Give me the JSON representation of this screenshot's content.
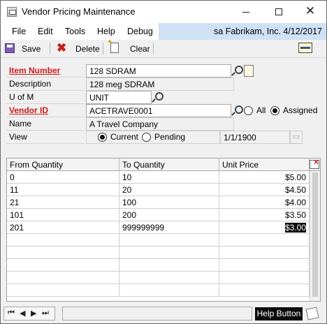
{
  "window": {
    "title": "Vendor Pricing Maintenance",
    "minimize": "–",
    "maximize": "☐",
    "close": "✕"
  },
  "menu": {
    "items": [
      "File",
      "Edit",
      "Tools",
      "Help",
      "Debug"
    ],
    "context": "sa  Fabrikam, Inc.  4/12/2017"
  },
  "toolbar": {
    "save_label": "Save",
    "delete_label": "Delete",
    "clear_label": "Clear"
  },
  "form": {
    "item_number_label": "Item Number",
    "item_number_value": "128 SDRAM",
    "description_label": "Description",
    "description_value": "128 meg SDRAM",
    "uofm_label": "U of M",
    "uofm_value": "UNIT",
    "vendor_id_label": "Vendor ID",
    "vendor_id_value": "ACETRAVE0001",
    "vendor_scope": {
      "options": [
        "All",
        "Assigned"
      ],
      "selected": "Assigned"
    },
    "name_label": "Name",
    "name_value": "A Travel Company",
    "view_label": "View",
    "view_options": {
      "options": [
        "Current",
        "Pending"
      ],
      "selected": "Current"
    },
    "view_date": "1/1/1900"
  },
  "grid": {
    "columns": [
      "From Quantity",
      "To Quantity",
      "Unit Price"
    ],
    "rows": [
      [
        "0",
        "10",
        "$5.00"
      ],
      [
        "11",
        "20",
        "$4.50"
      ],
      [
        "21",
        "100",
        "$4.00"
      ],
      [
        "101",
        "200",
        "$3.50"
      ],
      [
        "201",
        "999999999",
        "$3.00"
      ]
    ],
    "empty_rows": 5
  },
  "statusbar": {
    "help_button": "Help Button"
  }
}
